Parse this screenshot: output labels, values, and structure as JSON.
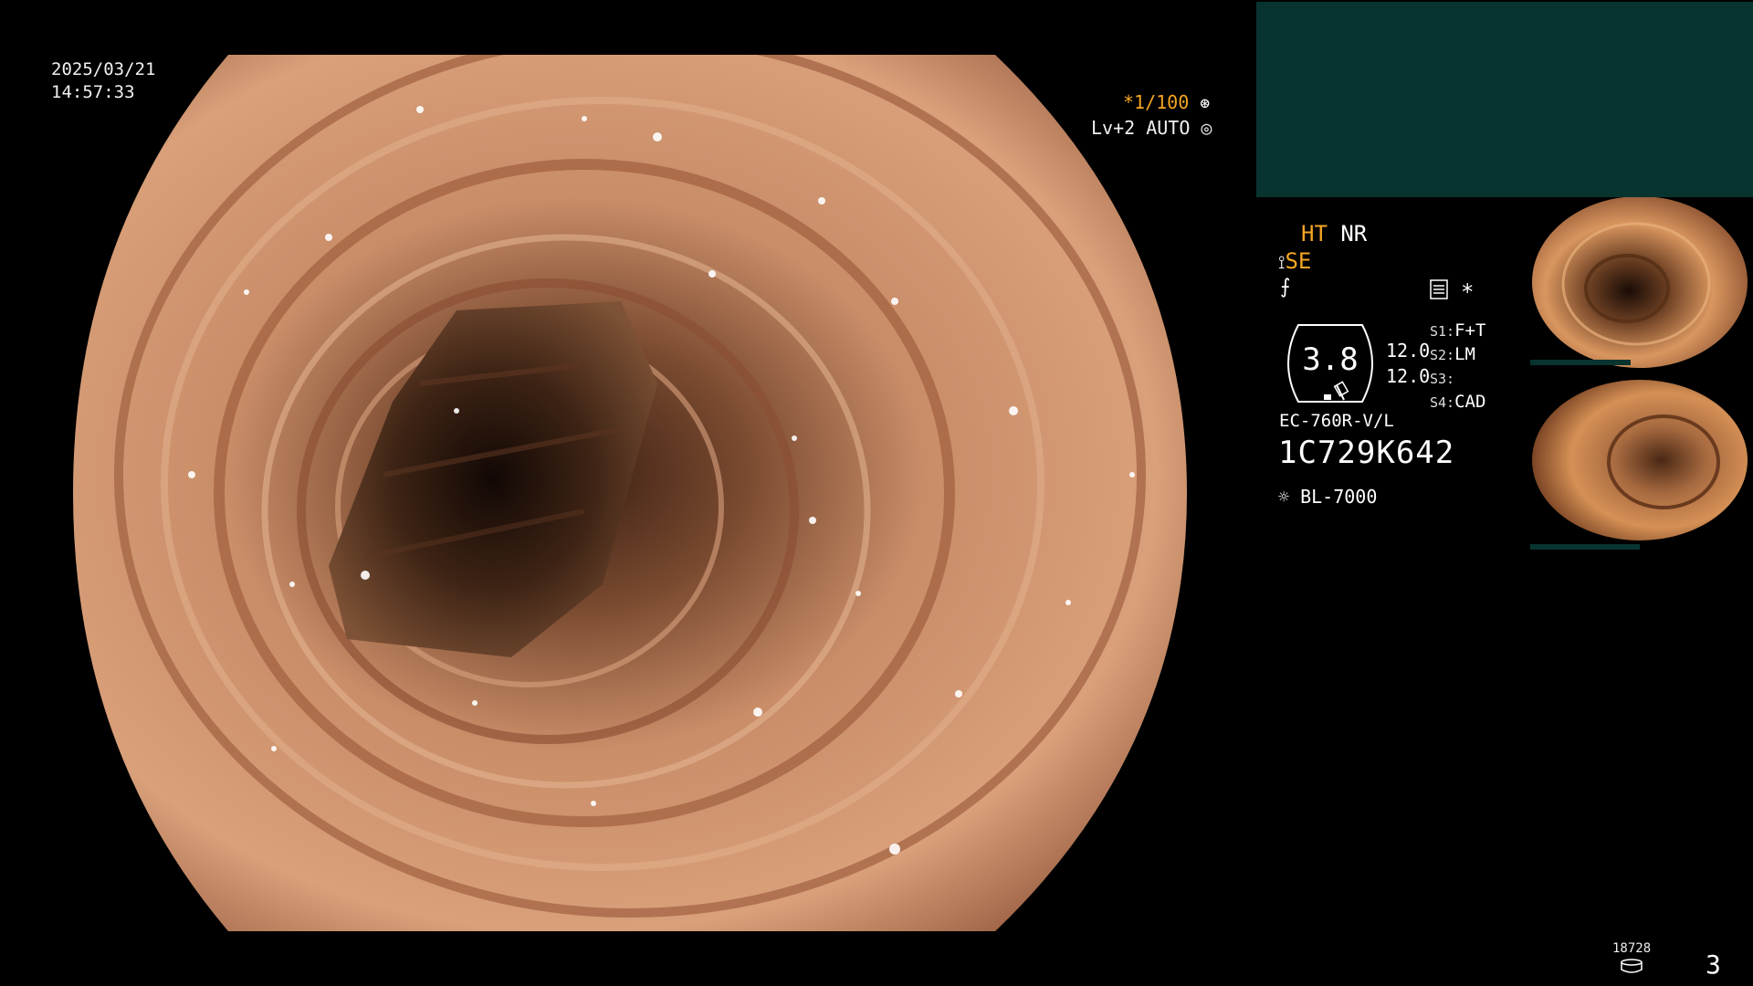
{
  "overlay": {
    "date": "2025/03/21",
    "time": "14:57:33",
    "shutter": "*1/100",
    "level": "Lv+2 AUTO"
  },
  "status": {
    "ht": "HT",
    "nr": "NR",
    "se": "SE",
    "gauge_value": "3.8",
    "gauge_upper": "12.0",
    "gauge_lower": "12.0",
    "slots": [
      {
        "key": "S1:",
        "value": "F+T"
      },
      {
        "key": "S2:",
        "value": "LM"
      },
      {
        "key": "S3:",
        "value": ""
      },
      {
        "key": "S4:",
        "value": "CAD"
      }
    ],
    "asterisk": "*",
    "scope_model": "EC-760R-V/L",
    "serial": "1C729K642",
    "light_source": "BL-7000"
  },
  "footer": {
    "counter": "18728",
    "page": "3"
  },
  "icons": {
    "shutter": "aperture-icon",
    "level": "iris-icon",
    "scope": "scope-connector-icon",
    "freeze": "freeze-icon",
    "settings": "menu-card-icon",
    "light": "light-bulb-icon",
    "storage": "disk-icon"
  },
  "colors": {
    "accent": "#f5a623",
    "panel": "#083430",
    "tissue": "#c88a66"
  }
}
